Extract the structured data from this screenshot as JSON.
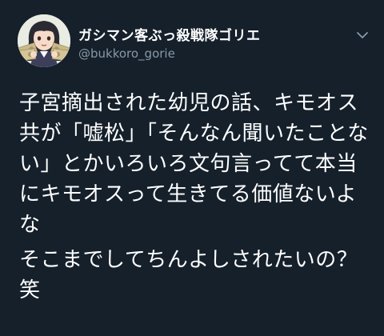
{
  "tweet": {
    "display_name": "ガシマン客ぶっ殺戦隊ゴリエ",
    "handle": "@bukkoro_gorie",
    "paragraphs": [
      "子宮摘出された幼児の話、キモオス共が「嘘松」「そんなん聞いたことない」とかいろいろ文句言ってて本当にキモオスって生きてる価値ないよな",
      "そこまでしてちんよしされたいの？笑"
    ]
  },
  "icons": {
    "avatar": "avatar-anime-girl-holding-banknotes",
    "menu": "chevron-down-icon"
  },
  "colors": {
    "background": "#15202b",
    "text": "#ffffff",
    "secondary_text": "#8899a6"
  }
}
